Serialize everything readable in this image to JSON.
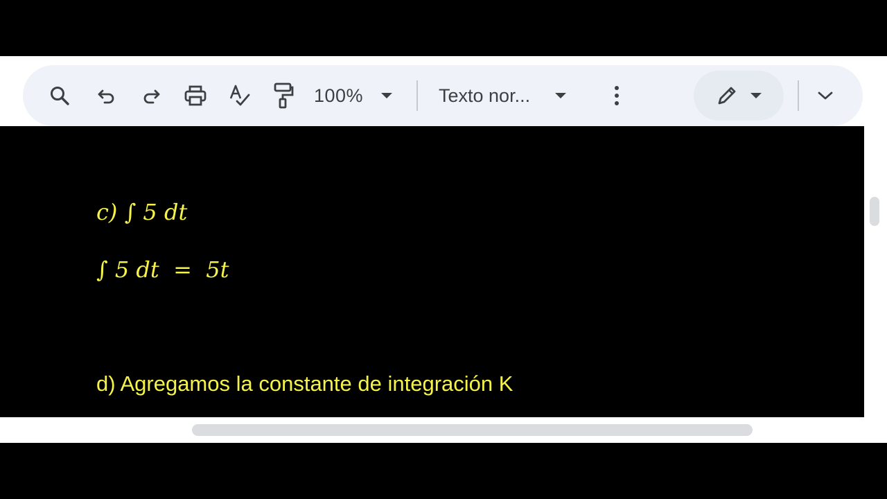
{
  "toolbar": {
    "icons": {
      "search": "search-icon",
      "undo": "undo-icon",
      "redo": "redo-icon",
      "print": "print-icon",
      "spellcheck": "spellcheck-icon",
      "paint_format": "paint-format-icon",
      "more": "more-vert-icon",
      "edit_mode": "pencil-icon",
      "collapse": "chevron-down-icon"
    },
    "zoom_value": "100%",
    "paragraph_style": "Texto nor..."
  },
  "document": {
    "line_c_label": "c) ∫ 5 dt",
    "line_c_result": "∫ 5 dt  =  5t",
    "line_d": "d) Agregamos la constante de integración K"
  },
  "colors": {
    "toolbar_bg": "#eff3f9",
    "canvas_bg": "#000000",
    "text_yellow": "#f5f34a",
    "icon_gray": "#3c4043"
  }
}
